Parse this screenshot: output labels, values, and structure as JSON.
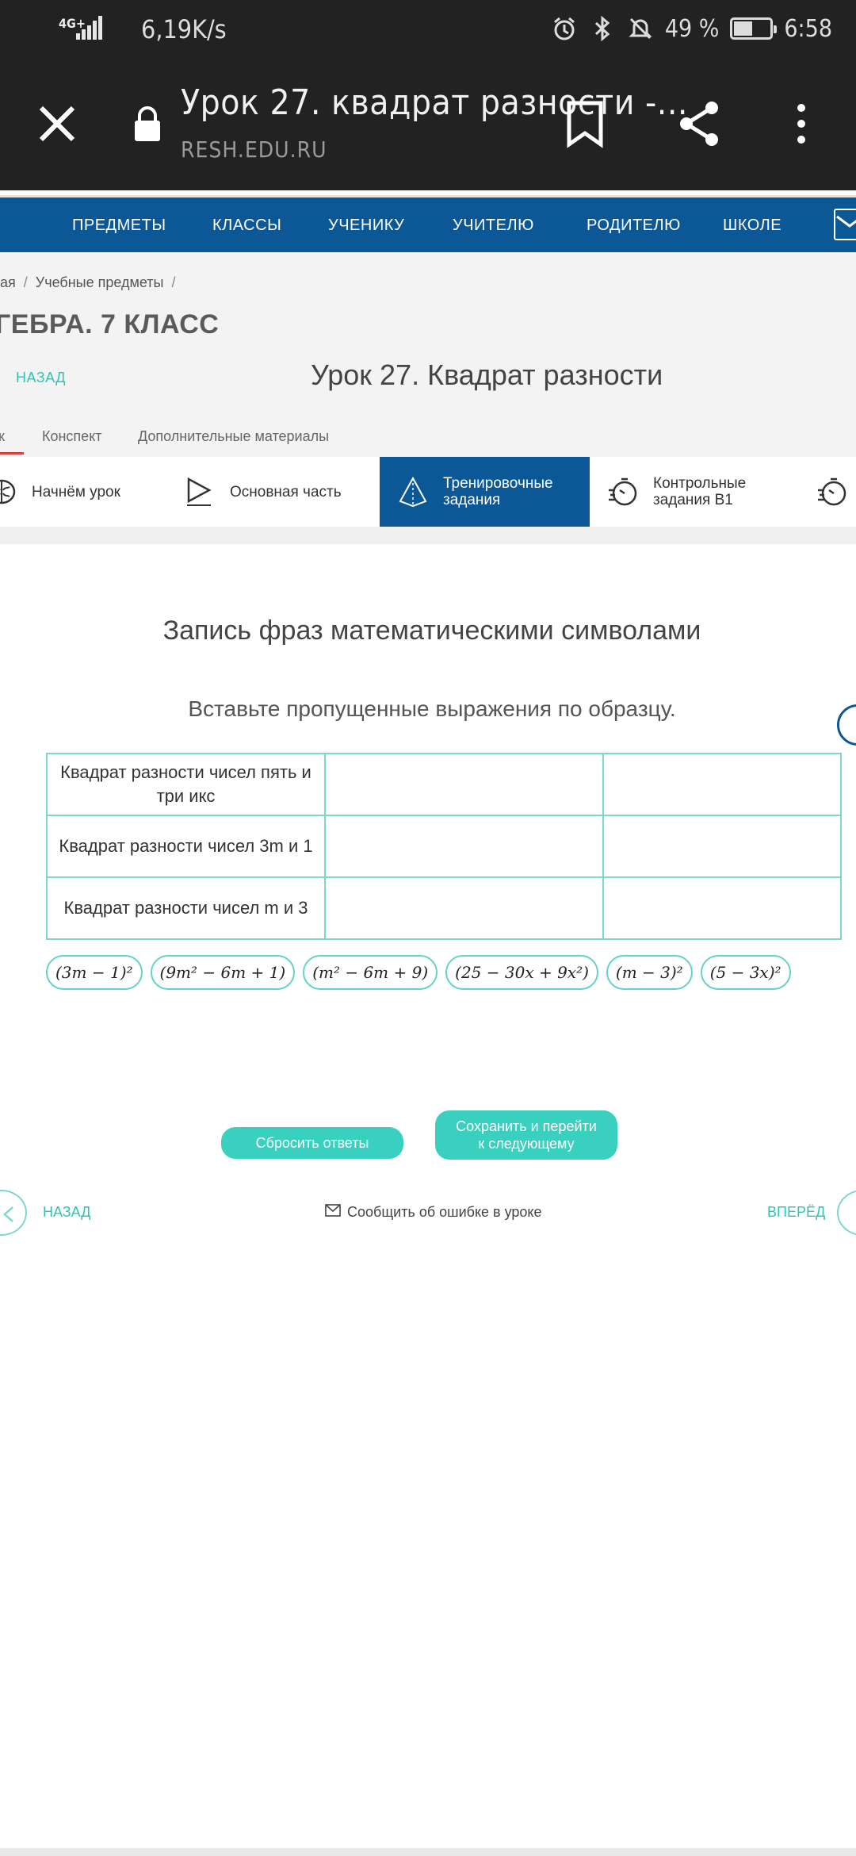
{
  "status_bar": {
    "network": "4G+",
    "speed": "6,19K/s",
    "battery": "49 %",
    "battery_level": 0.49,
    "time": "6:58"
  },
  "browser": {
    "title": "Урок 27. квадрат разности -...",
    "url": "RESH.EDU.RU"
  },
  "nav": {
    "items": [
      "ПРЕДМЕТЫ",
      "КЛАССЫ",
      "УЧЕНИКУ",
      "УЧИТЕЛЮ",
      "РОДИТЕЛЮ",
      "ШКОЛЕ"
    ]
  },
  "breadcrumb": {
    "items": [
      "ая",
      "Учебные предметы"
    ],
    "separator": "/"
  },
  "course_title": "ГЕБРА. 7 КЛАСС",
  "back_top": "НАЗАД",
  "lesson_title": "Урок 27. Квадрат разности",
  "tabs": [
    "к",
    "Конспект",
    "Дополнительные материалы"
  ],
  "steps": [
    {
      "label": "Начнём урок",
      "icon": "brain-icon"
    },
    {
      "label": "Основная часть",
      "icon": "play-icon"
    },
    {
      "label": "Тренировочные задания",
      "icon": "pyramid-icon",
      "active": true
    },
    {
      "label": "Контрольные задания B1",
      "icon": "stopwatch-icon"
    }
  ],
  "task": {
    "title": "Запись фраз математическими символами",
    "subtitle": "Вставьте пропущенные выражения по образцу."
  },
  "table_rows": [
    "Квадрат разности чисел пять и три икс",
    "Квадрат разности чисел 3m и 1",
    "Квадрат разности чисел m и 3"
  ],
  "chips": [
    "(3m − 1)²",
    "(9m² − 6m + 1)",
    "(m² − 6m + 9)",
    "(25 − 30x + 9x²)",
    "(m − 3)²",
    "(5 − 3x)²"
  ],
  "buttons": {
    "reset": "Сбросить ответы",
    "save": "Сохранить и перейти к следующему"
  },
  "footer_nav": {
    "back": "НАЗАД",
    "report": "Сообщить об ошибке в уроке",
    "next": "ВПЕРЁД"
  },
  "colors": {
    "nav_blue": "#0c5896",
    "accent_teal": "#3ad0bf",
    "status_dark": "#222222"
  }
}
